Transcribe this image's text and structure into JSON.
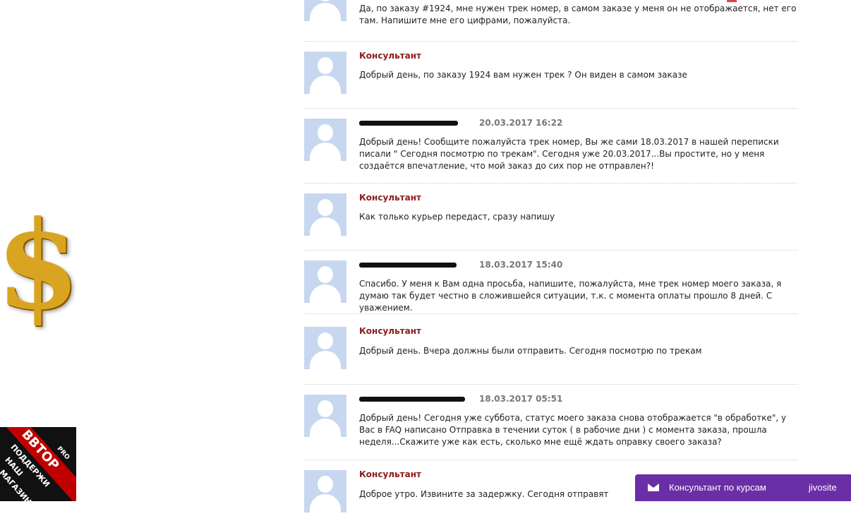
{
  "decor": {
    "dollar_glyph": "$",
    "badge": {
      "title": "ВВТОР",
      "pro": "PRO",
      "line1": "ПОДДЕРЖИ",
      "line2": "НАШ",
      "line3": "МАГАЗИН"
    }
  },
  "chat": {
    "messages": [
      {
        "author": "",
        "date": "",
        "text": "Да, по заказу #1924, мне нужен трек номер, в самом заказе у меня он не отображается, нет его там. Напишите мне его цифрами, пожалуйста."
      },
      {
        "author": "Консультант",
        "date": "",
        "text": "Добрый день, по заказу 1924 вам нужен трек ? Он виден в самом заказе"
      },
      {
        "author": "",
        "date": "20.03.2017 16:22",
        "text": "Добрый день! Сообщите пожалуйста трек номер, Вы же сами 18.03.2017 в нашей переписки писали \" Сегодня посмотрю по трекам\". Сегодня уже 20.03.2017...Вы простите, но у меня создаётся впечатление, что мой заказ до сих пор не отправлен?!"
      },
      {
        "author": "Консультант",
        "date": "",
        "text": "Как только курьер передаст, сразу напишу"
      },
      {
        "author": "",
        "date": "18.03.2017 15:40",
        "text": "Спасибо. У меня к Вам одна просьба, напишите, пожалуйста, мне трек номер моего заказа, я думаю так будет честно в сложившейся ситуации, т.к. с момента оплаты прошло 8 дней. С уважением."
      },
      {
        "author": "Консультант",
        "date": "",
        "text": "Добрый день. Вчера должны были отправить. Сегодня посмотрю по трекам"
      },
      {
        "author": "",
        "date": "18.03.2017 05:51",
        "text": "Добрый день! Сегодня уже суббота, статус моего заказа снова отображается \"в обработке\", у Вас в FAQ написано Отправка в течении суток ( в рабочие дни ) с момента заказа, прошла неделя...Скажите уже как есть, сколько мне ещё ждать оправку своего заказа?"
      },
      {
        "author": "Консультант",
        "date": "",
        "text": "Доброе утро. Извините за задержку. Сегодня отправят"
      }
    ]
  },
  "widget": {
    "label": "Консультант по курсам",
    "brand": "jivosite",
    "icon": "mail-icon"
  },
  "colors": {
    "consultant": "#8b1a1a",
    "avatar_bg": "#c7d7ef",
    "widget_bg": "#6a2ea6",
    "dollar": "#d9a520"
  }
}
